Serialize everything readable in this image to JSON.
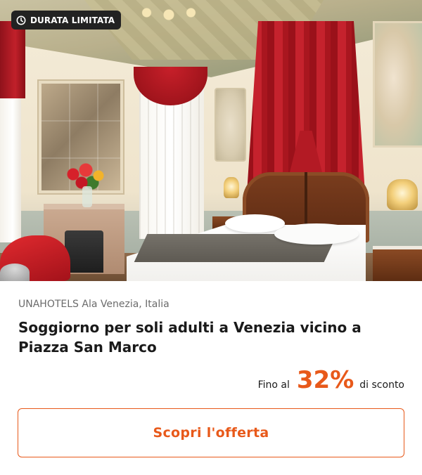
{
  "badge": {
    "icon": "clock-icon",
    "label": "DURATA LIMITATA"
  },
  "hotel": {
    "location": "UNAHOTELS Ala Venezia, Italia",
    "title": "Soggiorno per soli adulti a Venezia vicino a Piazza San Marco"
  },
  "discount": {
    "prefix": "Fino al",
    "value": "32%",
    "suffix": "di sconto"
  },
  "cta": {
    "label": "Scopri l'offerta"
  },
  "colors": {
    "accent": "#e8591a",
    "badge_bg": "#222222",
    "text_primary": "#1a1a1a",
    "text_secondary": "#6b6b6b"
  }
}
